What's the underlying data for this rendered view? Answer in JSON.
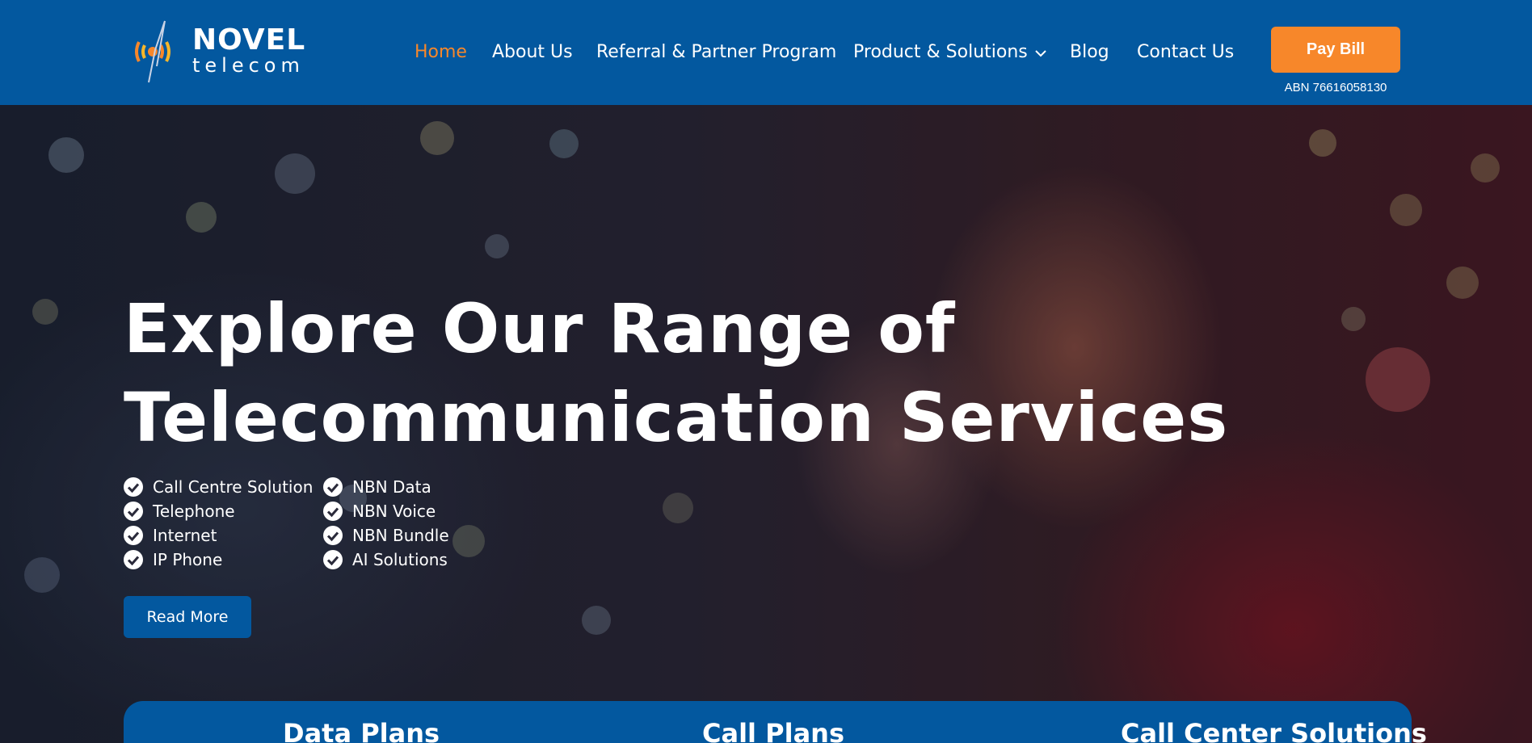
{
  "header": {
    "logo": {
      "word1": "NOVEL",
      "word2": "telecom"
    },
    "nav": [
      {
        "label": "Home",
        "active": true
      },
      {
        "label": "About Us"
      },
      {
        "label": "Referral & Partner Program"
      },
      {
        "label": "Product & Solutions",
        "has_dropdown": true
      },
      {
        "label": "Blog"
      },
      {
        "label": "Contact Us"
      }
    ],
    "pay_bill_label": "Pay Bill",
    "abn": "ABN 76616058130"
  },
  "hero": {
    "title_line1": "Explore Our Range of",
    "title_line2": "Telecommunication Services",
    "features_left": [
      "Call Centre Solution",
      "Telephone",
      "Internet",
      "IP Phone"
    ],
    "features_right": [
      "NBN Data",
      "NBN Voice",
      "NBN Bundle",
      "AI Solutions"
    ],
    "read_more_label": "Read More"
  },
  "plans": [
    "Data Plans",
    "Call Plans",
    "Call Center Solutions"
  ],
  "colors": {
    "brand_blue": "#03589f",
    "accent_orange": "#f7872a",
    "text_white": "#ffffff"
  },
  "icons": {
    "logo": "antenna-signal-logo",
    "check": "check-circle-icon",
    "dropdown": "chevron-down-icon"
  }
}
